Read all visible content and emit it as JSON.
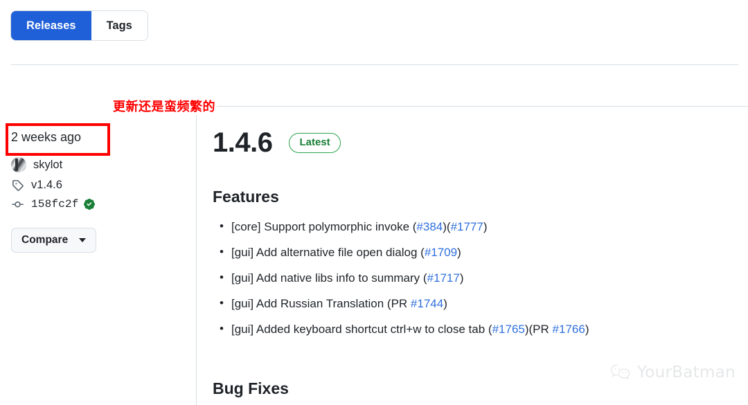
{
  "tabs": [
    {
      "label": "Releases",
      "active": true
    },
    {
      "label": "Tags",
      "active": false
    }
  ],
  "annotation": {
    "text": "更新还是蛮频繁的",
    "color": "#ff0000",
    "highlight_target": "release-date"
  },
  "release_meta": {
    "date": "2 weeks ago",
    "author": "skylot",
    "tag_icon": "tag-icon",
    "tag": "v1.4.6",
    "commit_icon": "commit-icon",
    "commit": "158fc2f",
    "verified_icon": "verified-check-icon",
    "compare_label": "Compare",
    "compare_caret": "chevron-down-icon"
  },
  "release": {
    "version": "1.4.6",
    "badge": "Latest",
    "badge_color": "#2da44e",
    "sections": [
      {
        "heading": "Features",
        "items": [
          {
            "parts": [
              {
                "type": "text",
                "value": "[core] Support polymorphic invoke ("
              },
              {
                "type": "link",
                "value": "#384"
              },
              {
                "type": "text",
                "value": ")("
              },
              {
                "type": "link",
                "value": "#1777"
              },
              {
                "type": "text",
                "value": ")"
              }
            ]
          },
          {
            "parts": [
              {
                "type": "text",
                "value": "[gui] Add alternative file open dialog ("
              },
              {
                "type": "link",
                "value": "#1709"
              },
              {
                "type": "text",
                "value": ")"
              }
            ]
          },
          {
            "parts": [
              {
                "type": "text",
                "value": "[gui] Add native libs info to summary ("
              },
              {
                "type": "link",
                "value": "#1717"
              },
              {
                "type": "text",
                "value": ")"
              }
            ]
          },
          {
            "parts": [
              {
                "type": "text",
                "value": "[gui] Add Russian Translation (PR "
              },
              {
                "type": "link",
                "value": "#1744"
              },
              {
                "type": "text",
                "value": ")"
              }
            ]
          },
          {
            "parts": [
              {
                "type": "text",
                "value": "[gui] Added keyboard shortcut ctrl+w to close tab ("
              },
              {
                "type": "link",
                "value": "#1765"
              },
              {
                "type": "text",
                "value": ")(PR "
              },
              {
                "type": "link",
                "value": "#1766"
              },
              {
                "type": "text",
                "value": ")"
              }
            ]
          }
        ]
      },
      {
        "heading": "Bug Fixes",
        "items": []
      }
    ]
  },
  "watermark": {
    "icon": "wechat-icon",
    "text": "YourBatman"
  },
  "colors": {
    "accent_blue": "#1f5fd8",
    "link_blue": "#2f6fdd",
    "green": "#2da44e",
    "border": "#d8dee4",
    "annotation_red": "#ff0000"
  }
}
